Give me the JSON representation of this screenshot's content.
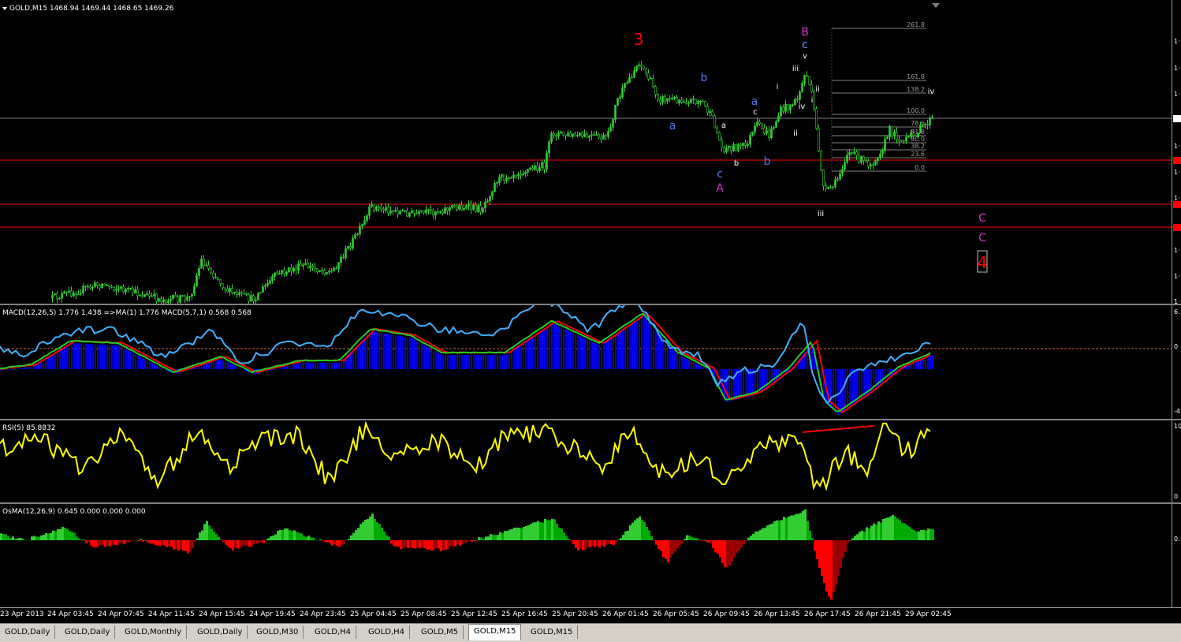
{
  "main": {
    "header": "GOLD,M15  1468.94 1469.44 1468.65 1469.26",
    "fib_levels": [
      {
        "label": "261.8"
      },
      {
        "label": "161.8"
      },
      {
        "label": "138.2"
      },
      {
        "label": "100.0"
      },
      {
        "label": "78.6"
      },
      {
        "label": "61.8"
      },
      {
        "label": "50.0"
      },
      {
        "label": "38.2"
      },
      {
        "label": "23.6"
      },
      {
        "label": "0.0"
      }
    ],
    "wave_labels": [
      {
        "text": "3",
        "color": "#ff0000",
        "size": "big"
      },
      {
        "text": "B",
        "color": "#cc33cc",
        "size": "mid"
      },
      {
        "text": "c",
        "color": "#6699ff",
        "size": "mid"
      },
      {
        "text": "v",
        "color": "#ffffff",
        "size": "small"
      },
      {
        "text": "iii",
        "color": "#ffffff",
        "size": "small"
      },
      {
        "text": "i",
        "color": "#ffffff",
        "size": "small"
      },
      {
        "text": "ii",
        "color": "#ffffff",
        "size": "small"
      },
      {
        "text": "i",
        "color": "#ffffff",
        "size": "small"
      },
      {
        "text": "iv",
        "color": "#ffffff",
        "size": "small"
      },
      {
        "text": "ii",
        "color": "#ffffff",
        "size": "small"
      },
      {
        "text": "iv",
        "color": "#ffffff",
        "size": "small"
      },
      {
        "text": "b",
        "color": "#5577ee",
        "size": "mid"
      },
      {
        "text": "a",
        "color": "#5577ee",
        "size": "mid"
      },
      {
        "text": "a",
        "color": "#ffffff",
        "size": "small"
      },
      {
        "text": "a",
        "color": "#5577ee",
        "size": "mid"
      },
      {
        "text": "c",
        "color": "#ffffff",
        "size": "small"
      },
      {
        "text": "b",
        "color": "#ffffff",
        "size": "small"
      },
      {
        "text": "c",
        "color": "#5577ee",
        "size": "mid"
      },
      {
        "text": "A",
        "color": "#cc33cc",
        "size": "mid"
      },
      {
        "text": "b",
        "color": "#5577ee",
        "size": "mid"
      },
      {
        "text": "iii",
        "color": "#ffffff",
        "size": "small"
      },
      {
        "text": "C",
        "color": "#cc33cc",
        "size": "mid"
      },
      {
        "text": "C",
        "color": "#cc33cc",
        "size": "mid"
      },
      {
        "text": "4",
        "color": "#ff0000",
        "size": "big"
      }
    ]
  },
  "macd": {
    "header": "MACD(12,26,5) 1.776 1.438  =>MA(1) 1.776  MACD(5,7,1) 0.568 0.568",
    "ticks": [
      "6.",
      "0",
      "-4"
    ]
  },
  "rsi": {
    "header": "RSI(5) 85.8832",
    "ticks": [
      "10",
      "0"
    ]
  },
  "osma": {
    "header": "OsMA(12,26,9) 0.645 0.000 0.000 0.000",
    "ticks": [
      "0."
    ]
  },
  "xaxis": {
    "labels": [
      "23 Apr 2013",
      "24 Apr 03:45",
      "24 Apr 07:45",
      "24 Apr 11:45",
      "24 Apr 15:45",
      "24 Apr 19:45",
      "24 Apr 23:45",
      "25 Apr 04:45",
      "25 Apr 08:45",
      "25 Apr 12:45",
      "25 Apr 16:45",
      "25 Apr 20:45",
      "26 Apr 01:45",
      "26 Apr 05:45",
      "26 Apr 09:45",
      "26 Apr 13:45",
      "26 Apr 17:45",
      "26 Apr 21:45",
      "29 Apr 02:45"
    ]
  },
  "tabs": [
    {
      "label": "GOLD,Daily",
      "active": false
    },
    {
      "label": "GOLD,Daily",
      "active": false
    },
    {
      "label": "GOLD,Monthly",
      "active": false
    },
    {
      "label": "GOLD,Daily",
      "active": false
    },
    {
      "label": "GOLD,M30",
      "active": false
    },
    {
      "label": "GOLD,H4",
      "active": false
    },
    {
      "label": "GOLD,H4",
      "active": false
    },
    {
      "label": "GOLD,M5",
      "active": false
    },
    {
      "label": "GOLD,M15",
      "active": true
    },
    {
      "label": "GOLD,M15",
      "active": false
    }
  ],
  "colors": {
    "candle": "#33cc33",
    "grid_line": "#808080",
    "support_line": "#ff0000",
    "macd_hist": "#0000ee",
    "macd_red": "#ff0000",
    "macd_green": "#22cc22",
    "macd_cyan": "#3fb0ff",
    "rsi": "#ffff00",
    "osma_up_light": "#33cc33",
    "osma_up_dark": "#00aa00",
    "osma_down_light": "#ff0000",
    "osma_down_dark": "#990000"
  },
  "chart_data": [
    {
      "type": "candlestick",
      "title": "GOLD,M15",
      "price_path": [
        [
          1,
          1
        ],
        [
          0.3,
          0.0
        ],
        [
          0.0,
          0.18
        ],
        [
          0.2,
          0.3
        ],
        [
          0.2,
          0.35
        ],
        [
          0.25,
          0.28
        ],
        [
          0.28,
          0.33
        ],
        [
          0.3,
          0.35
        ],
        [
          0.36,
          0.45
        ],
        [
          0.4,
          0.5
        ],
        [
          0.43,
          0.55
        ],
        [
          0.47,
          0.68
        ],
        [
          0.5,
          0.7
        ],
        [
          0.5,
          0.72
        ],
        [
          0.54,
          0.75
        ],
        [
          0.58,
          0.76
        ],
        [
          0.63,
          0.76
        ],
        [
          0.66,
          0.78
        ],
        [
          0.7,
          0.79
        ]
      ]
    },
    {
      "type": "line",
      "title": "MACD(12,26,5)"
    },
    {
      "type": "line",
      "title": "RSI(5)"
    },
    {
      "type": "bar",
      "title": "OsMA(12,26,9)"
    }
  ]
}
